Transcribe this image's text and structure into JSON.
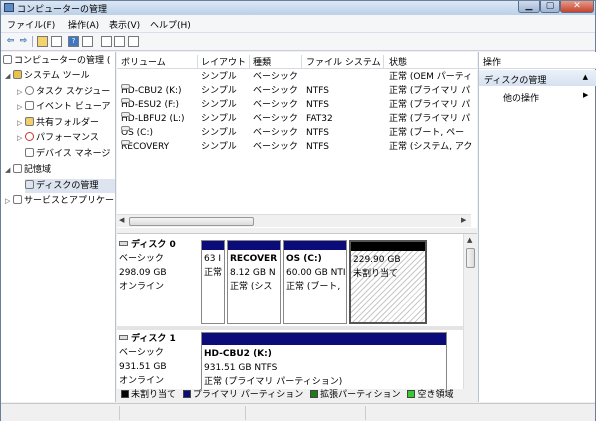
{
  "window": {
    "title": "コンピューターの管理",
    "minimize": "▁",
    "maximize": "▢",
    "close": "✕"
  },
  "menu": [
    "ファイル(F)",
    "操作(A)",
    "表示(V)",
    "ヘルプ(H)"
  ],
  "toolbar": {
    "back": "⇦",
    "forward": "⇨"
  },
  "tree": {
    "root": "コンピューターの管理 (",
    "system_tools": "システム ツール",
    "task_scheduler": "タスク スケジュー",
    "event_viewer": "イベント ビューア",
    "shared_folders": "共有フォルダー",
    "performance": "パフォーマンス",
    "device_manager": "デバイス マネージ",
    "storage": "記憶域",
    "disk_management": "ディスクの管理",
    "services": "サービスとアプリケー"
  },
  "volume_list": {
    "columns": [
      "ボリューム",
      "レイアウト",
      "種類",
      "ファイル システム",
      "状態"
    ],
    "rows": [
      [
        "",
        "シンプル",
        "ベーシック",
        "",
        "正常 (OEM パーティ"
      ],
      [
        "HD-CBU2 (K:)",
        "シンプル",
        "ベーシック",
        "NTFS",
        "正常 (プライマリ パ"
      ],
      [
        "HD-ESU2 (F:)",
        "シンプル",
        "ベーシック",
        "NTFS",
        "正常 (プライマリ パ"
      ],
      [
        "HD-LBFU2 (L:)",
        "シンプル",
        "ベーシック",
        "FAT32",
        "正常 (プライマリ パ"
      ],
      [
        "OS (C:)",
        "シンプル",
        "ベーシック",
        "NTFS",
        "正常 (ブート, ペー"
      ],
      [
        "RECOVERY",
        "シンプル",
        "ベーシック",
        "NTFS",
        "正常 (システム, アク"
      ]
    ]
  },
  "disks": [
    {
      "name": "ディスク 0",
      "type": "ベーシック",
      "size": "298.09 GB",
      "status": "オンライン",
      "partitions": [
        {
          "name": "",
          "size": "63 I",
          "fs": "",
          "status": "正常"
        },
        {
          "name": "RECOVER",
          "size": "8.12 GB N",
          "fs": "",
          "status": "正常 (シス"
        },
        {
          "name": "OS  (C:)",
          "size": "60.00 GB NTI",
          "fs": "",
          "status": "正常 (ブート,"
        },
        {
          "name": "",
          "size": "229.90 GB",
          "fs": "",
          "status": "未割り当て"
        }
      ]
    },
    {
      "name": "ディスク 1",
      "type": "ベーシック",
      "size": "931.51 GB",
      "status": "オンライン",
      "partitions": [
        {
          "name": "HD-CBU2  (K:)",
          "size": "931.51 GB NTFS",
          "status": "正常 (プライマリ パーティション)"
        }
      ]
    }
  ],
  "legend": [
    {
      "label": "未割り当て",
      "color": "#000000"
    },
    {
      "label": "プライマリ パーティション",
      "color": "#0b0b7a"
    },
    {
      "label": "拡張パーティション",
      "color": "#1f7a1f"
    },
    {
      "label": "空き領域",
      "color": "#33cc33"
    }
  ],
  "actions": {
    "header": "操作",
    "section": "ディスクの管理",
    "more": "他の操作"
  }
}
